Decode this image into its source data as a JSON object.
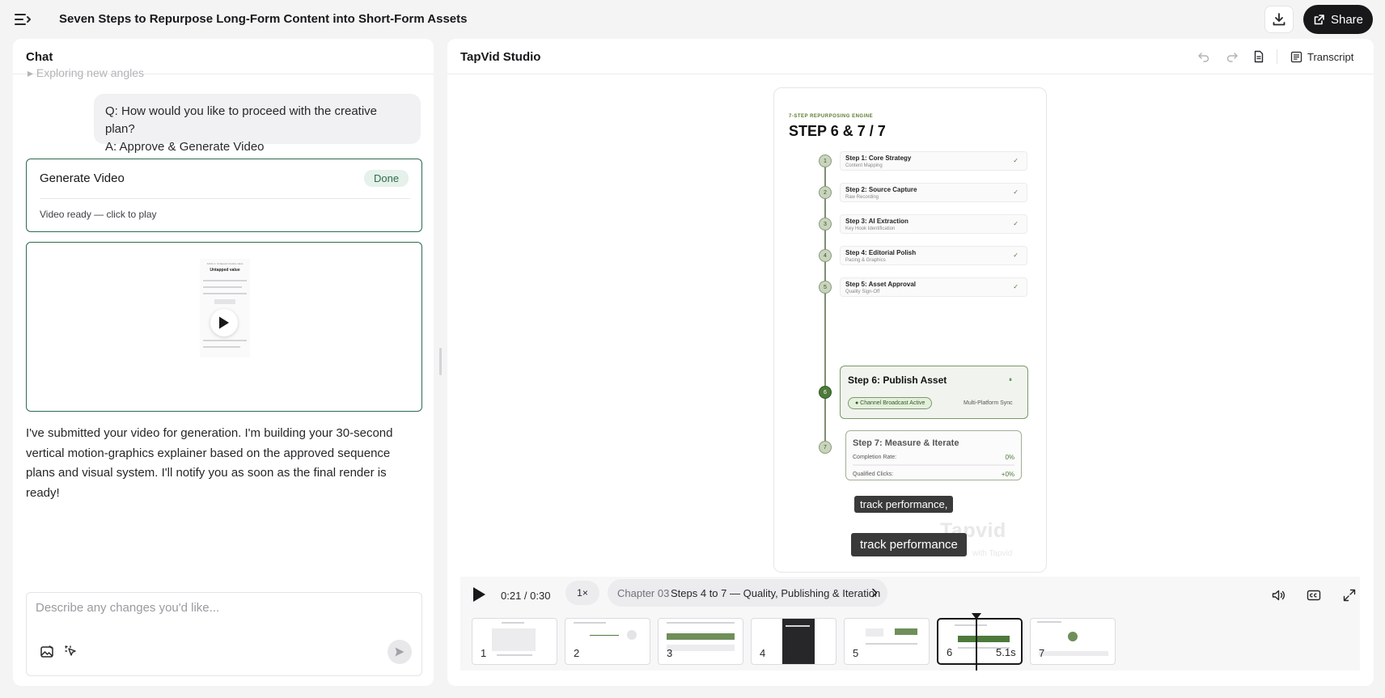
{
  "topbar": {
    "title": "Seven Steps to Repurpose Long-Form Content into Short-Form Assets",
    "share_label": "Share"
  },
  "chat": {
    "header": "Chat",
    "faded_text": "Exploring new angles",
    "user_message": {
      "question": "Q: How would you like to proceed with the creative plan?",
      "answer": "A: Approve & Generate Video"
    },
    "generate_card": {
      "title": "Generate Video",
      "status": "Done",
      "subtitle": "Video ready — click to play"
    },
    "video_thumb": {
      "kicker": "Article 1: Untapped creative value",
      "title": "Untapped value"
    },
    "assistant_message": "I've submitted your video for generation. I'm building your 30-second vertical motion-graphics explainer based on the approved sequence plans and visual system. I'll notify you as soon as the final render is ready!",
    "composer": {
      "placeholder": "Describe any changes you'd like..."
    }
  },
  "studio": {
    "title": "TapVid Studio",
    "transcript_label": "Transcript",
    "preview": {
      "kicker": "7-STEP REPURPOSING ENGINE",
      "heading": "STEP 6 & 7 / 7",
      "steps": [
        {
          "num": "1",
          "title": "Step 1: Core Strategy",
          "sub": "Content Mapping",
          "check": "✓"
        },
        {
          "num": "2",
          "title": "Step 2: Source Capture",
          "sub": "Raw Recording",
          "check": "✓"
        },
        {
          "num": "3",
          "title": "Step 3: AI Extraction",
          "sub": "Key Hook Identification",
          "check": "✓"
        },
        {
          "num": "4",
          "title": "Step 4: Editorial Polish",
          "sub": "Pacing & Graphics",
          "check": "✓"
        },
        {
          "num": "5",
          "title": "Step 5: Asset Approval",
          "sub": "Quality Sign-Off",
          "check": "✓"
        }
      ],
      "step6": {
        "num": "6",
        "title": "Step 6: Publish Asset",
        "pause_glyph": "⏸",
        "pill": "● Channel Broadcast Active",
        "sync": "Multi-Platform Sync"
      },
      "step7": {
        "num": "7",
        "title": "Step 7: Measure & Iterate",
        "metric1_label": "Completion Rate:",
        "metric1_value": "0%",
        "metric2_label": "Qualified Clicks:",
        "metric2_value": "+0%"
      },
      "caption_upper": "track performance,",
      "caption_lower": "track performance",
      "watermark": "Tapvid",
      "watermark_sub": "with Tapvid"
    },
    "playback": {
      "time": "0:21 / 0:30",
      "progress": 0.7,
      "speed": "1×",
      "chapter_label": "Chapter 03",
      "chapter_name": "Steps 4 to 7 — Quality, Publishing & Iteration"
    },
    "timeline": {
      "thumbnails": [
        {
          "num": "1",
          "duration": ""
        },
        {
          "num": "2",
          "duration": ""
        },
        {
          "num": "3",
          "duration": ""
        },
        {
          "num": "4",
          "duration": ""
        },
        {
          "num": "5",
          "duration": ""
        },
        {
          "num": "6",
          "duration": "5.1s"
        },
        {
          "num": "7",
          "duration": ""
        }
      ],
      "active_index": 5
    }
  },
  "colors": {
    "accent_green": "#2f6b4e",
    "step_green": "#4d7a3a",
    "dark": "#18181b"
  }
}
